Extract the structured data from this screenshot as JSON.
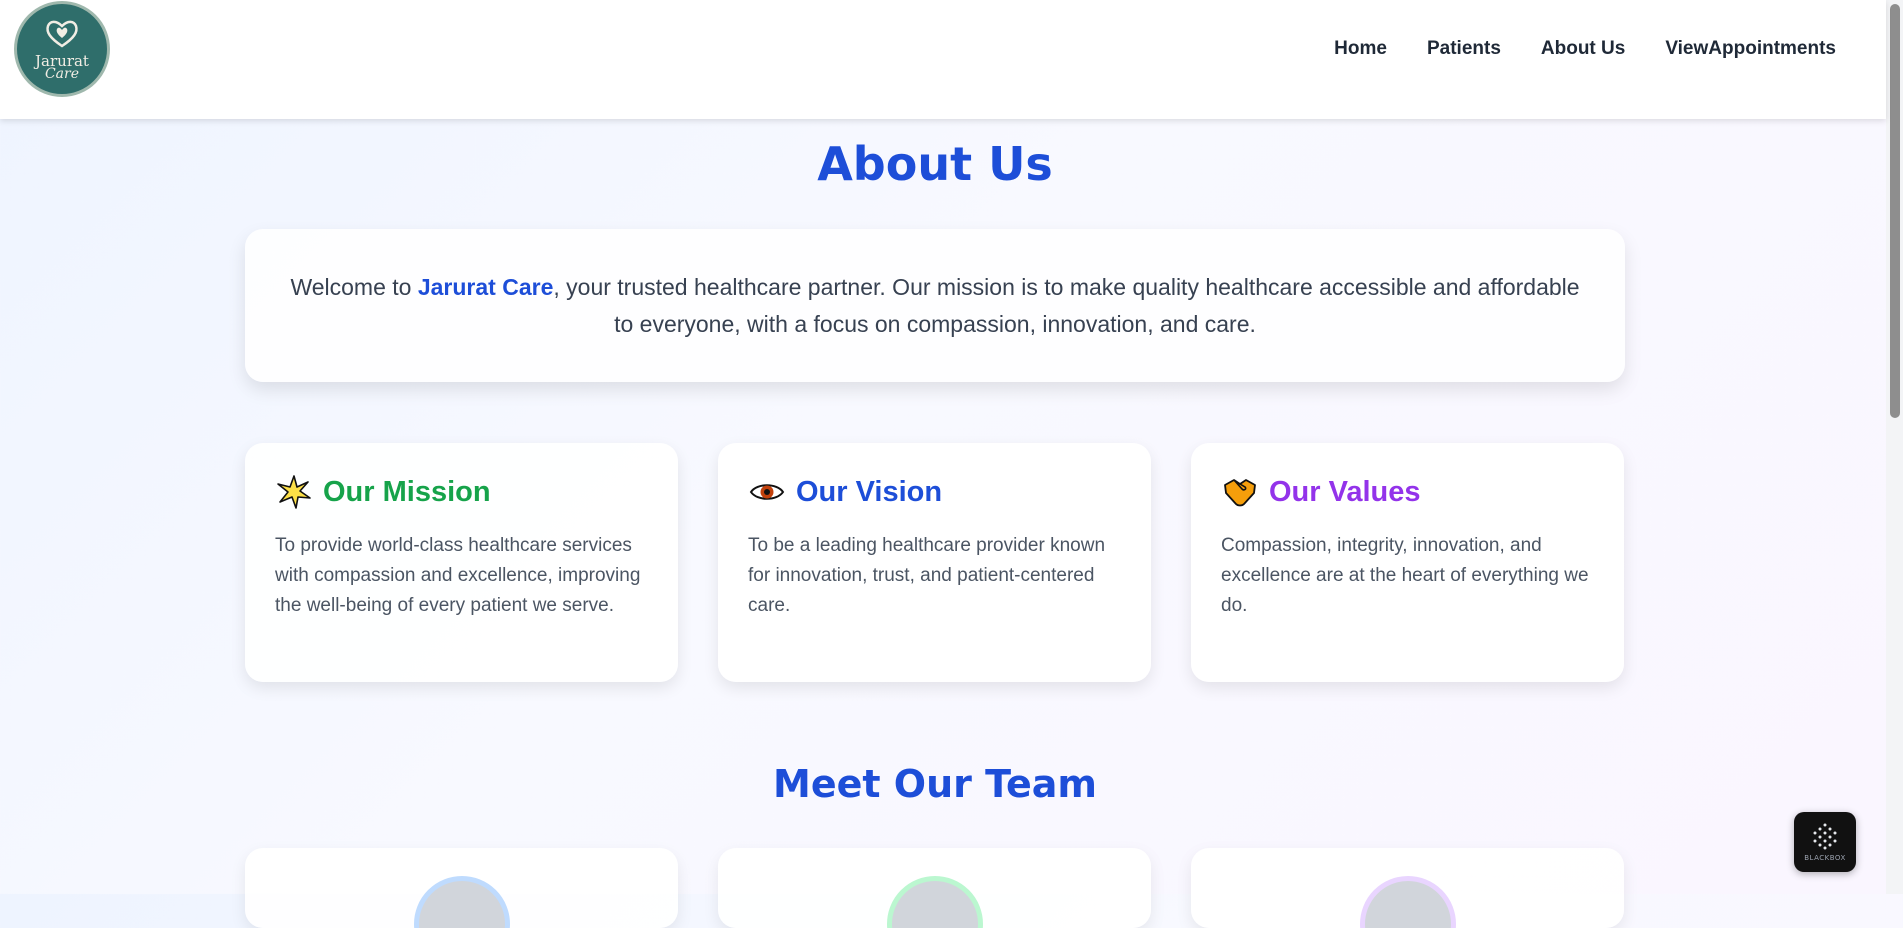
{
  "brand": {
    "logo_line1": "Jarurat",
    "logo_line2": "Care"
  },
  "nav": {
    "items": [
      {
        "label": "Home"
      },
      {
        "label": "Patients"
      },
      {
        "label": "About Us"
      },
      {
        "label": "ViewAppointments"
      }
    ]
  },
  "about": {
    "title": "About Us",
    "intro_before": "Welcome to ",
    "intro_brand": "Jarurat Care",
    "intro_after": ", your trusted healthcare partner. Our mission is to make quality healthcare accessible and affordable to everyone, with a focus on compassion, innovation, and care."
  },
  "features": [
    {
      "icon": "star-icon",
      "glyph": "🌟",
      "title": "Our Mission",
      "color": "#16a34a",
      "desc": "To provide world-class healthcare services with compassion and excellence, improving the well-being of every patient we serve."
    },
    {
      "icon": "eye-icon",
      "glyph": "👁️",
      "title": "Our Vision",
      "color": "#1d4ed8",
      "desc": "To be a leading healthcare provider known for innovation, trust, and patient-centered care."
    },
    {
      "icon": "handshake-icon",
      "glyph": "🤝",
      "title": "Our Values",
      "color": "#9333ea",
      "desc": "Compassion, integrity, innovation, and excellence are at the heart of everything we do."
    }
  ],
  "team": {
    "title": "Meet Our Team",
    "avatar_ring_colors": [
      "#bfdbfe",
      "#bbf7d0",
      "#e9d5ff"
    ]
  },
  "widget": {
    "label": "BLACKBOX"
  }
}
